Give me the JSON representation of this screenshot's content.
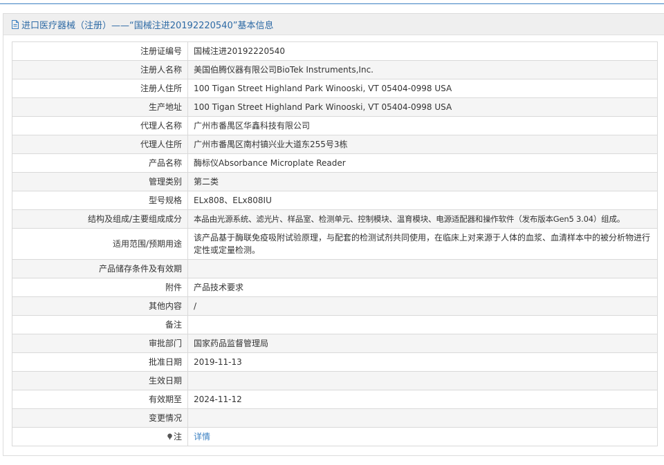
{
  "header": {
    "title": "进口医疗器械（注册）——“国械注进20192220540”基本信息",
    "icon": "document-icon"
  },
  "rows": [
    {
      "label": "注册证编号",
      "value": "国械注进20192220540"
    },
    {
      "label": "注册人名称",
      "value": "美国伯腾仪器有限公司BioTek Instruments,Inc."
    },
    {
      "label": "注册人住所",
      "value": "100 Tigan Street Highland Park Winooski, VT 05404-0998 USA"
    },
    {
      "label": "生产地址",
      "value": "100 Tigan Street Highland Park Winooski, VT 05404-0998 USA"
    },
    {
      "label": "代理人名称",
      "value": "广州市番禺区华鑫科技有限公司"
    },
    {
      "label": "代理人住所",
      "value": "广州市番禺区南村镇兴业大道东255号3栋"
    },
    {
      "label": "产品名称",
      "value": "酶标仪Absorbance Microplate Reader"
    },
    {
      "label": "管理类别",
      "value": "第二类"
    },
    {
      "label": "型号规格",
      "value": "ELx808、ELx808IU"
    },
    {
      "label": "结构及组成/主要组成成分",
      "value": "本品由光源系统、滤光片、样品室、检测单元、控制模块、温育模块、电源适配器和操作软件（发布版本Gen5 3.04）组成。"
    },
    {
      "label": "适用范围/预期用途",
      "value": "该产品基于酶联免疫吸附试验原理，与配套的检测试剂共同使用，在临床上对来源于人体的血浆、血清样本中的被分析物进行定性或定量检测。"
    },
    {
      "label": "产品储存条件及有效期",
      "value": ""
    },
    {
      "label": "附件",
      "value": "产品技术要求"
    },
    {
      "label": "其他内容",
      "value": "/"
    },
    {
      "label": "备注",
      "value": ""
    },
    {
      "label": "审批部门",
      "value": "国家药品监督管理局"
    },
    {
      "label": "批准日期",
      "value": "2019-11-13"
    },
    {
      "label": "生效日期",
      "value": ""
    },
    {
      "label": "有效期至",
      "value": "2024-11-12"
    },
    {
      "label": "变更情况",
      "value": ""
    },
    {
      "label": "注",
      "value": "详情",
      "icon": "pin-icon"
    }
  ],
  "colors": {
    "accent": "#3a7fc1",
    "header_bg": "#efefef",
    "alt_row_bg": "#f5f5f5",
    "border": "#d9d9d9"
  }
}
